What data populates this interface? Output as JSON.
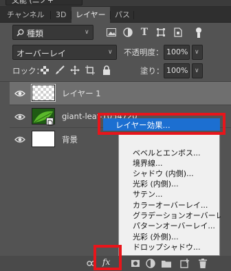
{
  "top": {
    "dropdown_label": "文能 (ニノ+"
  },
  "tabs": [
    {
      "label": "チャンネル"
    },
    {
      "label": "3D"
    },
    {
      "label": "レイヤー"
    },
    {
      "label": "パス"
    }
  ],
  "filter": {
    "kind_label": "種類",
    "icons": [
      "image-filter-icon",
      "adjustment-filter-icon",
      "type-filter-icon",
      "shape-filter-icon",
      "smart-object-filter-icon",
      "filter-toggle-icon"
    ]
  },
  "blend": {
    "mode": "オーバーレイ",
    "opacity_label": "不透明度：",
    "opacity_value": "100%"
  },
  "lock": {
    "label": "ロック：",
    "fill_label": "塗り：",
    "fill_value": "100%"
  },
  "layers": [
    {
      "name": "レイヤー 1",
      "selected": true
    },
    {
      "name": "giant-leaf-1054720",
      "selected": false
    },
    {
      "name": "背景",
      "selected": false
    }
  ],
  "context_menu": {
    "items": [
      {
        "label": "レイヤー効果..."
      },
      {
        "label": "ベベルとエンボス..."
      },
      {
        "label": "境界線..."
      },
      {
        "label": "シャドウ (内側)..."
      },
      {
        "label": "光彩 (内側)..."
      },
      {
        "label": "サテン..."
      },
      {
        "label": "カラーオーバーレイ..."
      },
      {
        "label": "グラデーションオーバーレイ..."
      },
      {
        "label": "パターンオーバーレイ..."
      },
      {
        "label": "光彩 (外側)..."
      },
      {
        "label": "ドロップシャドウ..."
      }
    ],
    "highlight_color": "#1c6fd1"
  },
  "bottom": {
    "fx_label": "fx"
  },
  "colors": {
    "panel": "#535353",
    "selected_layer": "#707070",
    "annotation_red": "#e8151b"
  }
}
